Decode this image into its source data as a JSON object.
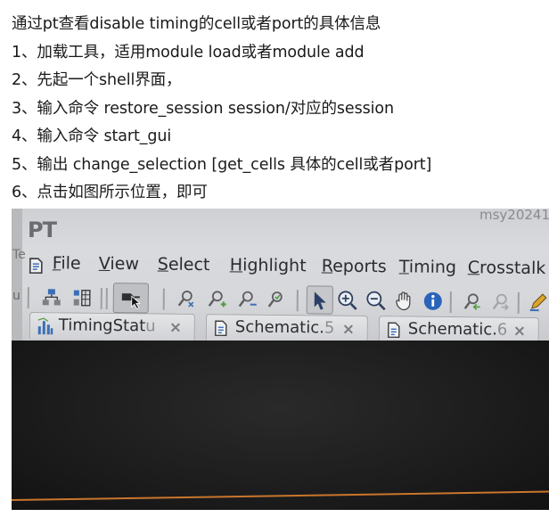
{
  "notes": {
    "lines": [
      "通过pt查看disable timing的cell或者port的具体信息",
      "1、加载工具，适用module load或者module add",
      "2、先起一个shell界面，",
      "3、输入命令 restore_session session/对应的session",
      "4、输入命令 start_gui",
      "5、输出 change_selection [get_cells   具体的cell或者port]",
      "6、点击如图所示位置，即可"
    ]
  },
  "screenshot": {
    "app_logo": "PT",
    "watermark": "msy20241",
    "menu": [
      {
        "mnemonic": "F",
        "rest": "ile"
      },
      {
        "mnemonic": "V",
        "rest": "iew"
      },
      {
        "mnemonic": "S",
        "rest": "elect"
      },
      {
        "mnemonic": "H",
        "rest": "ighlight"
      },
      {
        "mnemonic": "R",
        "rest": "eports"
      },
      {
        "mnemonic": "T",
        "rest": "iming"
      },
      {
        "mnemonic": "C",
        "rest": "rosstalk"
      }
    ],
    "tabs": [
      {
        "label": "TimingStat",
        "faded": "u",
        "close": "×",
        "icon": "bar-chart-icon"
      },
      {
        "label": "Schematic.",
        "faded": "5",
        "close": "×",
        "icon": "schematic-icon"
      },
      {
        "label": "Schematic.",
        "faded": "6",
        "close": "×",
        "icon": "schematic-icon"
      }
    ],
    "toolbar_icons": [
      "hierarchy-icon",
      "hierarchy-grid-icon",
      "selection-tool-icon",
      "zoom-fit-icon",
      "zoom-in-add-icon",
      "zoom-out-remove-icon",
      "zoom-select-icon",
      "pointer-arrow-icon",
      "zoom-in-icon",
      "zoom-out-icon",
      "pan-hand-icon",
      "info-icon",
      "back-icon",
      "forward-icon",
      "pen-icon"
    ],
    "colors": {
      "ui_gray": "#d6d7da",
      "dark_canvas": "#1b1b1c",
      "orange_line": "#c9762b",
      "icon_blue": "#3a6fb7",
      "icon_green": "#4f9a3c"
    }
  }
}
